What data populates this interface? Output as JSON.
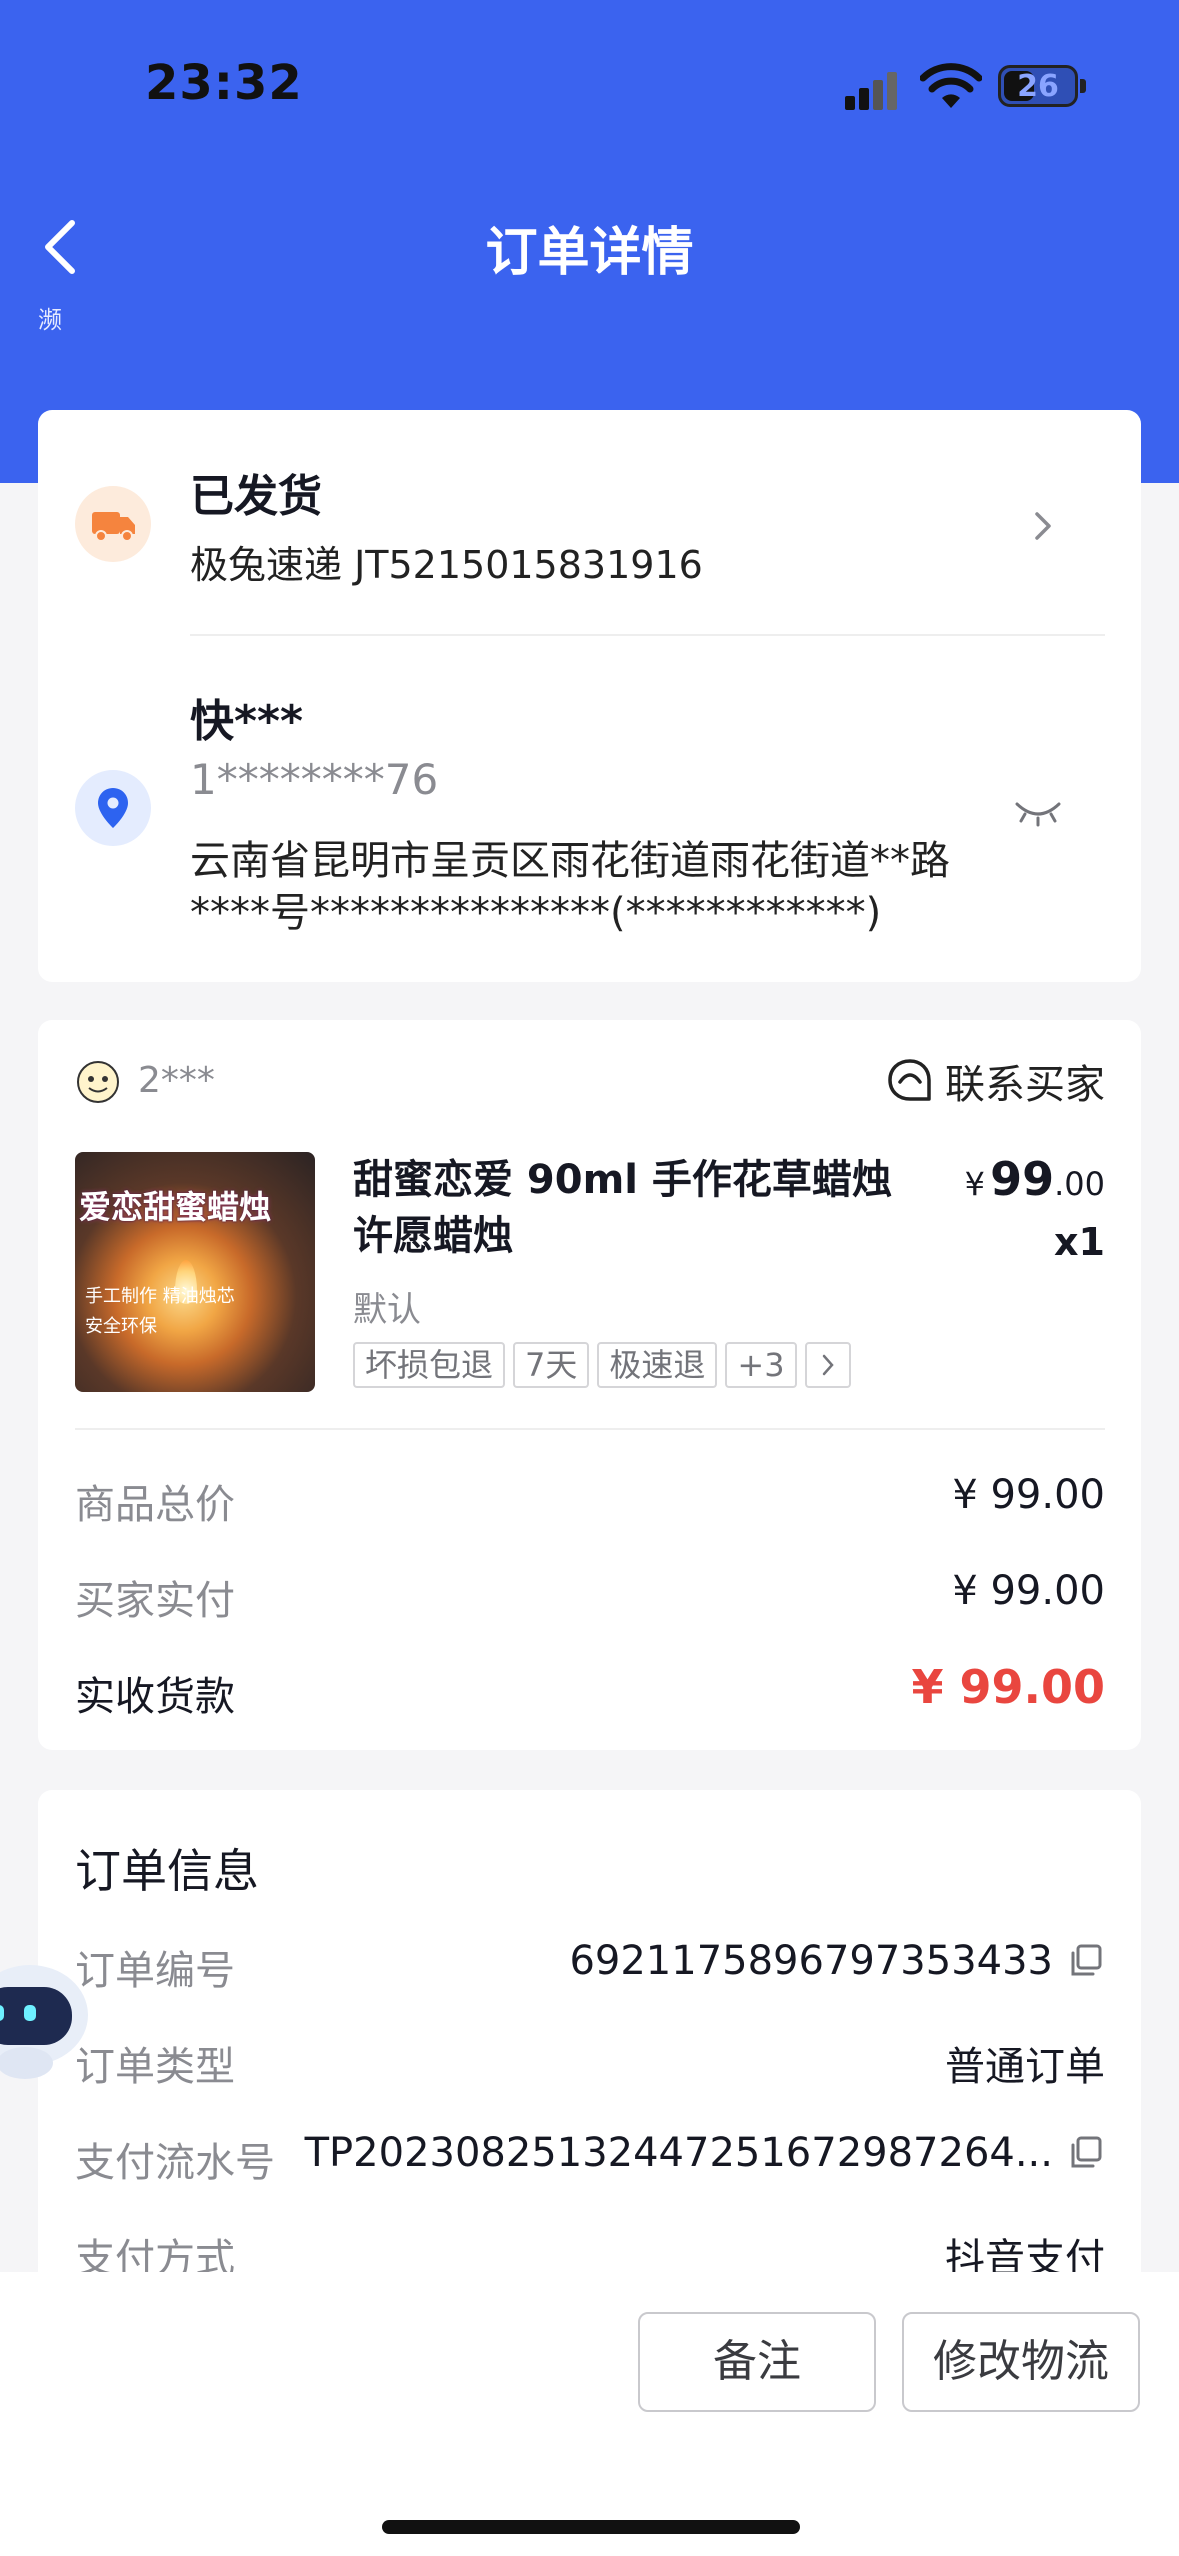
{
  "status_bar": {
    "time": "23:32",
    "battery": "26"
  },
  "nav": {
    "title": "订单详情",
    "hero_remnant": "濒"
  },
  "shipping": {
    "status": "已发货",
    "carrier_tracking": "极兔速递 JT5215015831916"
  },
  "address": {
    "name": "快***",
    "phone": "1********76",
    "line1": "云南省昆明市呈贡区雨花街道雨花街道**路",
    "line2": "****号***************(************)"
  },
  "shop": {
    "name": "2***",
    "contact_label": "联系买家"
  },
  "product": {
    "image_title": "爱恋甜蜜蜡烛",
    "image_checks": [
      "手工制作 精油烛芯",
      "安全环保"
    ],
    "title": "甜蜜恋爱 90ml 手作花草蜡烛许愿蜡烛",
    "price_symbol": "¥",
    "price_int": "99",
    "price_dec": ".00",
    "quantity": "x1",
    "spec": "默认",
    "tags": [
      "坏损包退",
      "7天",
      "极速退",
      "+3"
    ]
  },
  "pricing": [
    {
      "label": "商品总价",
      "value": "¥ 99.00"
    },
    {
      "label": "买家实付",
      "value": "¥ 99.00"
    },
    {
      "label": "实收货款",
      "value": "¥ 99.00"
    }
  ],
  "order_info": {
    "title": "订单信息",
    "rows": [
      {
        "label": "订单编号",
        "value": "6921175896797353433"
      },
      {
        "label": "订单类型",
        "value": "普通订单"
      },
      {
        "label": "支付流水号",
        "value": "TP2023082513244725167298726​4..."
      },
      {
        "label": "支付方式",
        "value": "抖音支付"
      }
    ]
  },
  "actions": {
    "note": "备注",
    "modify_logistics": "修改物流"
  },
  "colors": {
    "brand_blue": "#3b63ef",
    "price_red": "#e9463f",
    "ship_orange": "#f5843e"
  }
}
